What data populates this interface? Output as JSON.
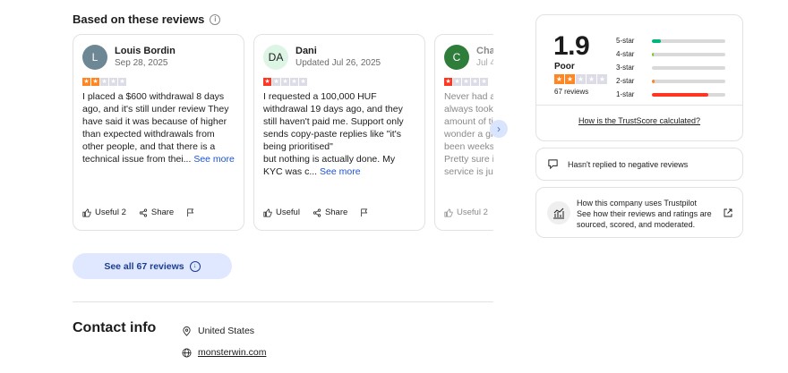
{
  "reviews_section": {
    "title": "Based on these reviews",
    "see_all_label": "See all 67 reviews"
  },
  "colors": {
    "star_orange": "#ff8622",
    "star_red": "#ff3722",
    "star_empty": "#dcdce6",
    "bar_green": "#00b67a",
    "bar_red": "#ff3722",
    "bar_orange": "#ff8622"
  },
  "reviews": [
    {
      "initial": "L",
      "avatar_bg": "#6d8795",
      "avatar_fg": "#ffffff",
      "name": "Louis Bordin",
      "date": "Sep 28, 2025",
      "rating": 2,
      "text": "I placed a $600 withdrawal 8 days ago, and it's still under review They have said it was because of higher than expected withdrawals from other people, and that there is a technical issue from thei... ",
      "see_more": "See more",
      "useful_label": "Useful 2",
      "share_label": "Share"
    },
    {
      "initial": "DA",
      "avatar_bg": "#ddf5e4",
      "avatar_fg": "#1c1c1c",
      "name": "Dani",
      "date": "Updated Jul 26, 2025",
      "rating": 1,
      "text": "I requested a 100,000 HUF withdrawal 19 days ago, and they still haven't paid me. Support only sends copy-paste replies like \"it's being prioritised\"\nbut nothing is actually done. My KYC was c... ",
      "see_more": "See more",
      "useful_label": "Useful",
      "share_label": "Share"
    },
    {
      "initial": "C",
      "avatar_bg": "#2f7d3b",
      "avatar_fg": "#ffffff",
      "name": "Char",
      "date": "Jul 4",
      "rating": 1,
      "text": "Never had a\nalways took\namount of ti\nwonder a gi\nbeen weeks\nPretty sure i\nservice is ju",
      "see_more": "",
      "useful_label": "Useful 2",
      "share_label": ""
    }
  ],
  "contact": {
    "title": "Contact info",
    "country": "United States",
    "website": "monsterwin.com"
  },
  "trustscore": {
    "score": "1.9",
    "word": "Poor",
    "rating": 2,
    "count": "67 reviews",
    "distribution": [
      {
        "label": "5-star",
        "fraction": 0.12,
        "color": "#00b67a"
      },
      {
        "label": "4-star",
        "fraction": 0.03,
        "color": "#73cf11"
      },
      {
        "label": "3-star",
        "fraction": 0.0,
        "color": "#ffce00"
      },
      {
        "label": "2-star",
        "fraction": 0.04,
        "color": "#ff8622"
      },
      {
        "label": "1-star",
        "fraction": 0.77,
        "color": "#ff3722"
      }
    ],
    "link_label": "How is the TrustScore calculated?"
  },
  "reply_note": "Hasn't replied to negative reviews",
  "how_company": {
    "title": "How this company uses Trustpilot",
    "text": "See how their reviews and ratings are sourced, scored, and moderated."
  }
}
